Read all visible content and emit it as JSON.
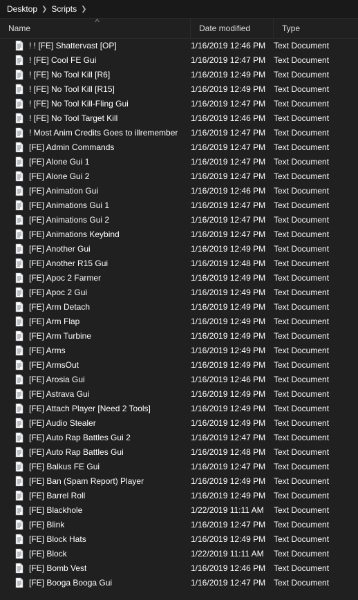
{
  "breadcrumb": {
    "parts": [
      "Desktop",
      "Scripts"
    ]
  },
  "columns": {
    "name": "Name",
    "date": "Date modified",
    "type": "Type",
    "sort_arrow": "˄"
  },
  "type_label": "Text Document",
  "files": [
    {
      "name": "! ! [FE] Shattervast [OP]",
      "date": "1/16/2019 12:46 PM"
    },
    {
      "name": "! [FE] Cool FE Gui",
      "date": "1/16/2019 12:47 PM"
    },
    {
      "name": "! [FE] No Tool Kill [R6]",
      "date": "1/16/2019 12:49 PM"
    },
    {
      "name": "! [FE] No Tool Kill [R15]",
      "date": "1/16/2019 12:49 PM"
    },
    {
      "name": "! [FE] No Tool Kill-Fling Gui",
      "date": "1/16/2019 12:47 PM"
    },
    {
      "name": "! [FE] No Tool Target Kill",
      "date": "1/16/2019 12:46 PM"
    },
    {
      "name": "! Most Anim Credits Goes to illremember",
      "date": "1/16/2019 12:47 PM"
    },
    {
      "name": "[FE] Admin Commands",
      "date": "1/16/2019 12:47 PM"
    },
    {
      "name": "[FE] Alone Gui 1",
      "date": "1/16/2019 12:47 PM"
    },
    {
      "name": "[FE] Alone Gui 2",
      "date": "1/16/2019 12:47 PM"
    },
    {
      "name": "[FE] Animation Gui",
      "date": "1/16/2019 12:46 PM"
    },
    {
      "name": "[FE] Animations Gui 1",
      "date": "1/16/2019 12:47 PM"
    },
    {
      "name": "[FE] Animations Gui 2",
      "date": "1/16/2019 12:47 PM"
    },
    {
      "name": "[FE] Animations Keybind",
      "date": "1/16/2019 12:47 PM"
    },
    {
      "name": "[FE] Another Gui",
      "date": "1/16/2019 12:49 PM"
    },
    {
      "name": "[FE] Another R15 Gui",
      "date": "1/16/2019 12:48 PM"
    },
    {
      "name": "[FE] Apoc 2 Farmer",
      "date": "1/16/2019 12:49 PM"
    },
    {
      "name": "[FE] Apoc 2 Gui",
      "date": "1/16/2019 12:49 PM"
    },
    {
      "name": "[FE] Arm Detach",
      "date": "1/16/2019 12:49 PM"
    },
    {
      "name": "[FE] Arm Flap",
      "date": "1/16/2019 12:49 PM"
    },
    {
      "name": "[FE] Arm Turbine",
      "date": "1/16/2019 12:49 PM"
    },
    {
      "name": "[FE] Arms",
      "date": "1/16/2019 12:49 PM"
    },
    {
      "name": "[FE] ArmsOut",
      "date": "1/16/2019 12:49 PM"
    },
    {
      "name": "[FE] Arosia Gui",
      "date": "1/16/2019 12:46 PM"
    },
    {
      "name": "[FE] Astrava Gui",
      "date": "1/16/2019 12:49 PM"
    },
    {
      "name": "[FE] Attach Player [Need 2 Tools]",
      "date": "1/16/2019 12:49 PM"
    },
    {
      "name": "[FE] Audio Stealer",
      "date": "1/16/2019 12:49 PM"
    },
    {
      "name": "[FE] Auto Rap Battles Gui 2",
      "date": "1/16/2019 12:47 PM"
    },
    {
      "name": "[FE] Auto Rap Battles Gui",
      "date": "1/16/2019 12:48 PM"
    },
    {
      "name": "[FE] Balkus FE Gui",
      "date": "1/16/2019 12:47 PM"
    },
    {
      "name": "[FE] Ban (Spam Report) Player",
      "date": "1/16/2019 12:49 PM"
    },
    {
      "name": "[FE] Barrel Roll",
      "date": "1/16/2019 12:49 PM"
    },
    {
      "name": "[FE] Blackhole",
      "date": "1/22/2019 11:11 AM"
    },
    {
      "name": "[FE] Blink",
      "date": "1/16/2019 12:47 PM"
    },
    {
      "name": "[FE] Block Hats",
      "date": "1/16/2019 12:49 PM"
    },
    {
      "name": "[FE] Block",
      "date": "1/22/2019 11:11 AM"
    },
    {
      "name": "[FE] Bomb Vest",
      "date": "1/16/2019 12:46 PM"
    },
    {
      "name": "[FE] Booga Booga Gui",
      "date": "1/16/2019 12:47 PM"
    }
  ]
}
